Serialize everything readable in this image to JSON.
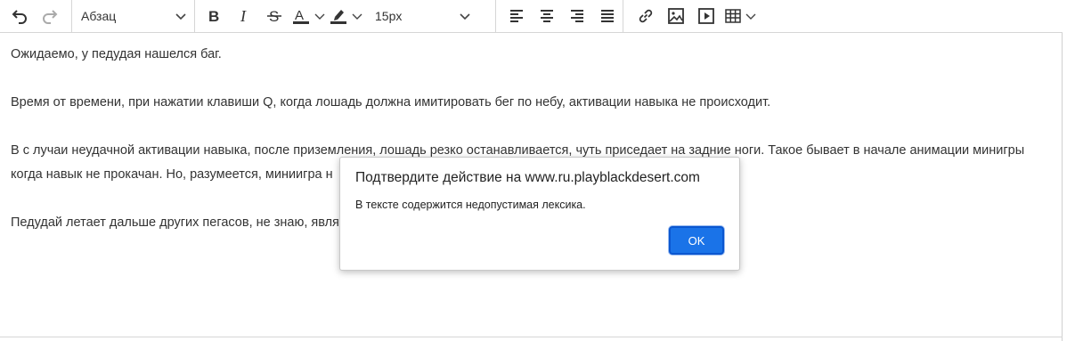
{
  "toolbar": {
    "paragraph_format": "Абзац",
    "font_size": "15px",
    "colors": {
      "text_color": "#333333",
      "highlight_color": "#333333",
      "icon": "#333333"
    }
  },
  "content": {
    "paragraphs": [
      "Ожидаемо, у педудая нашелся баг.",
      "Время от времени, при нажатии клавиши Q, когда лошадь должна имитировать бег по небу, активации навыка не происходит.",
      "В с лучаи неудачной активации навыка, после приземления, лошадь резко останавливается, чуть приседает на задние ноги. Такое бывает в начале анимации минигры когда навык не прокачан. Но, разумеется, миниигра н                                                                                                  анными.",
      "Педудай летает дальше других пегасов, не знаю, явля"
    ]
  },
  "dialog": {
    "title": "Подтвердите действие на www.ru.playblackdesert.com",
    "message": "В тексте содержится недопустимая лексика.",
    "ok_label": "OK",
    "accent": "#1a73e8"
  }
}
